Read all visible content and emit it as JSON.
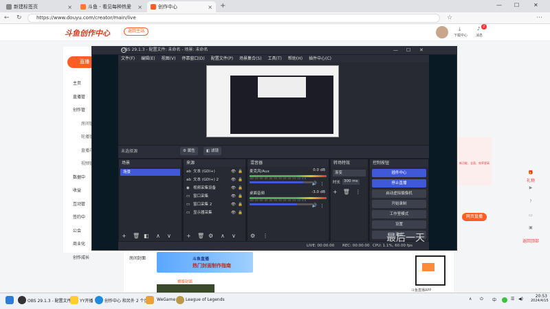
{
  "browser": {
    "tabs": [
      {
        "label": "新建标签页"
      },
      {
        "label": "斗鱼 - 看见每种热爱"
      },
      {
        "label": "创作中心"
      }
    ],
    "url": "https://www.douyu.com/creator/main/live",
    "new_tab": "+",
    "window_min": "—",
    "window_max": "☐",
    "window_close": "✕"
  },
  "site": {
    "logo": "斗鱼创作中心",
    "back_label": "返回主站",
    "download_label": "下载中心",
    "message_label": "消息",
    "message_badge": "2"
  },
  "sidebar": {
    "golive": "直播",
    "items": [
      {
        "label": "主页",
        "sub": false
      },
      {
        "label": "直播管",
        "sub": false
      },
      {
        "label": "创作管",
        "sub": false
      },
      {
        "label": "房间管",
        "sub": true
      },
      {
        "label": "轮播管",
        "sub": true
      },
      {
        "label": "直播花",
        "sub": true
      },
      {
        "label": "视频管",
        "sub": true
      },
      {
        "label": "数据中",
        "sub": false
      },
      {
        "label": "收益",
        "sub": false
      },
      {
        "label": "互动管",
        "sub": false
      },
      {
        "label": "签约中",
        "sub": false
      },
      {
        "label": "公会",
        "sub": false
      },
      {
        "label": "商业化",
        "sub": false
      },
      {
        "label": "创作成长",
        "sub": false
      }
    ]
  },
  "page": {
    "room_cover": "房间封面",
    "banner_title": "斗鱼直播",
    "banner_sub": "热门封面制作指南",
    "cover_example": "横版封面",
    "web_live_btn": "网页直播",
    "qr_caption": "斗鱼直播APP",
    "right_card_text": "新功能、全面、效率更高",
    "watermark": "最后一天"
  },
  "right_rail": [
    {
      "label": "礼物"
    },
    {
      "label": "返回顶部"
    }
  ],
  "obs": {
    "title": "OBS 29.1.3 - 配置文件: 未命名 - 场景: 未命名",
    "menu": [
      "文件(F)",
      "编辑(E)",
      "视图(V)",
      "停靠窗口(D)",
      "配置文件(P)",
      "场景集合(S)",
      "工具(T)",
      "帮助(H)",
      "插件中心(C)"
    ],
    "no_source": "未选择源",
    "properties": "属性",
    "filters": "滤镜",
    "panels": {
      "scenes": "场景",
      "sources": "来源",
      "mixer": "混音器",
      "transitions": "转场特效",
      "controls": "控制按钮"
    },
    "scenes": [
      "场景"
    ],
    "sources": [
      "文本 (GDI+)",
      "文本 (GDI+) 2",
      "视频采集设备",
      "窗口采集",
      "窗口采集 2",
      "显示器采集"
    ],
    "mixer": [
      {
        "name": "麦克风/Aux",
        "db": "0.0 dB",
        "level": 0.85
      },
      {
        "name": "桌面音频",
        "db": "-3.0 dB",
        "level": 0.75
      }
    ],
    "mixer_scale": "-60 -55 -50 -45 -40 -35 -30 -25 -20 -15 -10 -5 0",
    "transition": {
      "type": "渐变",
      "duration_label": "时长",
      "duration": "300 ms"
    },
    "controls": [
      "插件中心",
      "停止直播",
      "启动虚拟摄像机",
      "开始录制",
      "工作室模式",
      "设置",
      "退出"
    ],
    "status": {
      "live": "LIVE: 00:00:00",
      "rec": "REC: 00:00:00",
      "cpu": "CPU: 1.1%, 60.00 fps"
    }
  },
  "taskbar": {
    "items": [
      {
        "label": "OBS 29.1.3 - 配置文件: 未"
      },
      {
        "label": "YY开播"
      },
      {
        "label": "创作中心 和另外 2 个页"
      },
      {
        "label": "WeGame"
      },
      {
        "label": "League of Legends"
      }
    ],
    "ime": "中",
    "time": "20:53",
    "date": "2024/4/15"
  }
}
